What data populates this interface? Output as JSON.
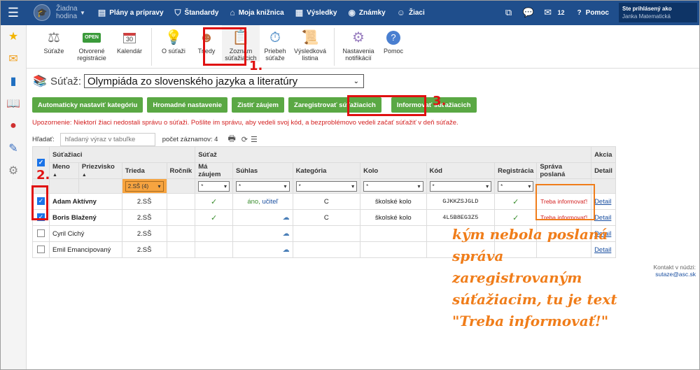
{
  "topbar": {
    "hodina_label": "Žiadna hodina",
    "nav": [
      {
        "label": "Plány a prípravy",
        "icon": "plans-icon"
      },
      {
        "label": "Štandardy",
        "icon": "shield-icon"
      },
      {
        "label": "Moja knižnica",
        "icon": "library-icon"
      },
      {
        "label": "Výsledky",
        "icon": "results-icon"
      },
      {
        "label": "Známky",
        "icon": "grades-icon"
      },
      {
        "label": "Žiaci",
        "icon": "students-icon"
      }
    ],
    "message_count": "12",
    "help_label": "Pomoc",
    "user_line1": "Ste prihlásený ako",
    "user_line2": "Janka Matematická"
  },
  "toolbar": {
    "items": [
      {
        "label": "Súťaže",
        "icon": "scales-icon"
      },
      {
        "label": "Otvorené registrácie",
        "icon": "open-sign-icon",
        "sign_text": "OPEN"
      },
      {
        "label": "Kalendár",
        "icon": "calendar-icon",
        "day": "30"
      },
      {
        "label": "O súťaži",
        "icon": "lightbulb-icon"
      },
      {
        "label": "Triedy",
        "icon": "person-icon"
      },
      {
        "label": "Zoznam súťažiacich",
        "icon": "clipboard-icon"
      },
      {
        "label": "Priebeh súťaže",
        "icon": "stopwatch-icon"
      },
      {
        "label": "Výsledková listina",
        "icon": "certificate-icon"
      },
      {
        "label": "Nastavenia notifikácií",
        "icon": "gear-icon"
      },
      {
        "label": "Pomoc",
        "icon": "help-icon"
      }
    ]
  },
  "sutaz": {
    "label": "Súťaž:",
    "selected": "Olympiáda zo slovenského jazyka a literatúry"
  },
  "buttons": {
    "auto_category": "Automaticky nastaviť kategóriu",
    "bulk_setting": "Hromadné nastavenie",
    "find_interest": "Zistiť záujem",
    "register": "Zaregistrovať súťažiacich",
    "inform": "Informovať súťažiacich"
  },
  "warning": "Upozornenie: Niektorí žiaci nedostali správu o súťaži. Pošlite im správu, aby vedeli svoj kód, a bezproblémovo vedeli začať súťažiť v deň súťaže.",
  "search": {
    "label": "Hľadať:",
    "placeholder": "hľadaný výraz v tabuľke",
    "count": "počet záznamov: 4"
  },
  "table": {
    "group_students": "Súťažiaci",
    "group_contest": "Súťaž",
    "group_action": "Akcia",
    "headers": {
      "meno": "Meno",
      "priezvisko": "Priezvisko",
      "trieda": "Trieda",
      "rocnik": "Ročník",
      "zaujem": "Má záujem",
      "suhlas": "Súhlas",
      "kategoria": "Kategória",
      "kolo": "Kolo",
      "kod": "Kód",
      "registracia": "Registrácia",
      "sprava": "Správa poslaná",
      "detail": "Detail"
    },
    "filter_default": "*",
    "filter_trieda": "2.SŠ (4)",
    "rows": [
      {
        "name": "Adam Aktívny",
        "trieda": "2.SŠ",
        "zaujem": "✓",
        "suhlas_ano": "áno,",
        "suhlas_kto": "učiteľ",
        "kategoria": "C",
        "kolo": "školské kolo",
        "kod": "GJKKZSJGLD",
        "registracia": "✓",
        "sprava": "Treba informovať!",
        "detail": "Detail",
        "checked": true
      },
      {
        "name": "Boris Blažený",
        "trieda": "2.SŠ",
        "zaujem": "✓",
        "kategoria": "C",
        "kolo": "školské kolo",
        "kod": "4L5B8EG3Z5",
        "registracia": "✓",
        "sprava": "Treba informovať!",
        "detail": "Detail",
        "checked": true
      },
      {
        "name": "Cyril Cichý",
        "trieda": "2.SŠ",
        "detail": "Detail",
        "checked": false
      },
      {
        "name": "Emil Emancipovaný",
        "trieda": "2.SŠ",
        "detail": "Detail",
        "checked": false
      }
    ]
  },
  "annotations": {
    "n1": "1.",
    "n2": "2.",
    "n3": "3.",
    "note": "kým nebola poslaná správa zaregistrovaným súťažiacim, tu je text \"Treba informovať!\""
  },
  "contact": {
    "label": "Kontakt v núdzi:",
    "email": "sutaze@asc.sk"
  },
  "colors": {
    "topbar": "#1f4e8c",
    "button_green": "#5aa844",
    "annotation_red": "#e01010",
    "annotation_orange": "#f07d1a"
  }
}
